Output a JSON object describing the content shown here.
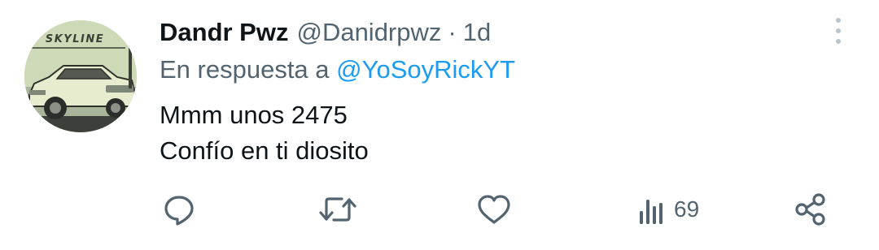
{
  "tweet": {
    "display_name": "Dandr Pwz",
    "handle": "@Danidrpwz",
    "separator": "·",
    "time": "1d",
    "reply_prefix": "En respuesta a",
    "reply_mention": "@YoSoyRickYT",
    "text_lines": [
      "Mmm unos 2475",
      "Confío en ti diosito"
    ]
  },
  "avatar": {
    "brand_text": "SKYLINE"
  },
  "actions": {
    "reply_icon": "reply-icon",
    "retweet_icon": "retweet-icon",
    "like_icon": "heart-icon",
    "views_icon": "views-icon",
    "views_count": "69",
    "share_icon": "share-icon"
  },
  "colors": {
    "text_primary": "#0f1419",
    "text_secondary": "#536471",
    "link": "#1d9bf0"
  }
}
